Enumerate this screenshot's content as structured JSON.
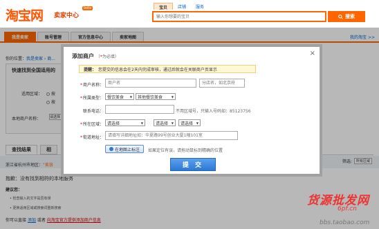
{
  "header": {
    "logo": "淘宝网",
    "logo_sub": "卖家中心",
    "logo_beta": "beta",
    "search_tabs": [
      "宝贝",
      "店铺",
      "服务"
    ],
    "search_placeholder": "输入你想要的宝贝",
    "search_button": "搜索"
  },
  "nav": {
    "tabs": [
      "我是卖家",
      "账号管理",
      "官方信息中心",
      "卖家地图"
    ],
    "right_link": "我的淘宝 >>"
  },
  "page": {
    "breadcrumb_prefix": "你的位置：",
    "breadcrumb": "我是卖家 › 商...",
    "side_title": "快速找到全国适用的",
    "side_label_1": "适用区域：",
    "side_option_1": "按",
    "side_option_2": "按",
    "side_label_2": "本地商户名称：",
    "side_select": "请选择",
    "result_tab_1": "查找结果",
    "result_tab_2": "相",
    "region_text": "浙江省杭州市地区：",
    "region_highlight": "\"美容",
    "filter_label": "筛选:",
    "filter_value": "所有区域",
    "no_result": "抱歉：没有找到相符的本地服务",
    "suggest_title": "建议您：",
    "suggestions": [
      "• 检查输入的文字是否有误",
      "• 更换适用区域或搜索词重新搜索"
    ],
    "footer_prefix": "你可以直接",
    "footer_link": "添加",
    "footer_mid": "或者",
    "footer_red": "向淘宝官方提供添加商户信息"
  },
  "modal": {
    "title": "添加商户",
    "required_note_prefix": "（",
    "required_star": "*",
    "required_note_suffix": "为必填）",
    "close": "×",
    "notice_bold": "提醒：",
    "notice_text": "您提交的信息会在2天内完成审核，通过后就会在关联商户页显示",
    "label_name": "商户名称：",
    "name_placeholder": "商户名",
    "branch_placeholder": "分店名，如北京府",
    "label_type": "所属类型：",
    "type_1": "餐饮美食",
    "type_2": "其他餐饮美食",
    "label_phone": "联系电话：",
    "phone_hint": "不用区域号，只输入号码如：85123756",
    "label_region": "所在区域：",
    "region_1": "请选择",
    "region_2": "请选择",
    "region_3": "请选择",
    "label_address": "街道地址：",
    "address_placeholder": "请填写详细地址如：华夏路99号创业大厦1幢101室",
    "map_button": "在地图上标注",
    "map_hint": "如果定位有误，请拖动鼠标到精确的位置",
    "submit": "提 交"
  },
  "watermark": {
    "line1": "货源批发网",
    "line2": "6pf.cn",
    "line3": "bbs.taobao.com"
  },
  "colors": {
    "brand": "#ff6600",
    "link": "#0066cc",
    "submit": "#2c78d4",
    "notice_bg": "#fff8d6"
  }
}
